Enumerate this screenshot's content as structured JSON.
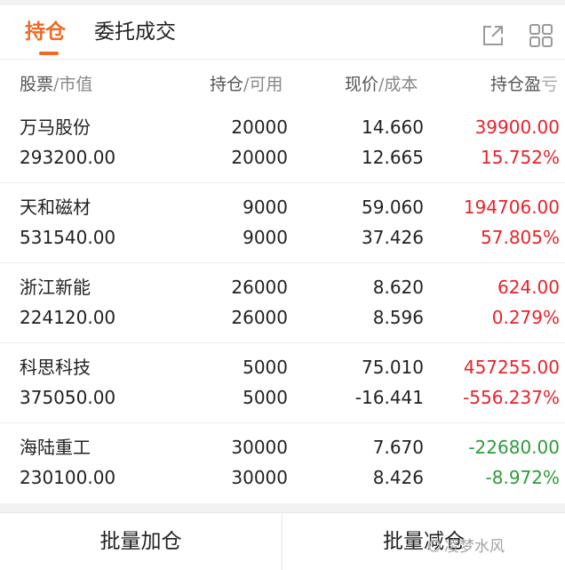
{
  "tabs": {
    "active": "持仓",
    "inactive": "委托成交"
  },
  "columns": {
    "stock": "股票",
    "stock_sub": "/市值",
    "qty": "持仓",
    "qty_sub": "/可用",
    "price": "现价",
    "price_sub": "/成本",
    "pnl": "持仓盈",
    "pnl_cut": "亏"
  },
  "holdings": [
    {
      "name": "万马股份",
      "market_value": "293200.00",
      "qty": "20000",
      "available": "20000",
      "price": "14.660",
      "cost": "12.665",
      "pnl": "39900.00",
      "pnl_pct": "15.752%",
      "pnl_sign": "pos"
    },
    {
      "name": "天和磁材",
      "market_value": "531540.00",
      "qty": "9000",
      "available": "9000",
      "price": "59.060",
      "cost": "37.426",
      "pnl": "194706.00",
      "pnl_pct": "57.805%",
      "pnl_sign": "pos"
    },
    {
      "name": "浙江新能",
      "market_value": "224120.00",
      "qty": "26000",
      "available": "26000",
      "price": "8.620",
      "cost": "8.596",
      "pnl": "624.00",
      "pnl_pct": "0.279%",
      "pnl_sign": "pos"
    },
    {
      "name": "科思科技",
      "market_value": "375050.00",
      "qty": "5000",
      "available": "5000",
      "price": "75.010",
      "cost": "-16.441",
      "pnl": "457255.00",
      "pnl_pct": "-556.237%",
      "pnl_sign": "pos"
    },
    {
      "name": "海陆重工",
      "market_value": "230100.00",
      "qty": "30000",
      "available": "30000",
      "price": "7.670",
      "cost": "8.426",
      "pnl": "-22680.00",
      "pnl_pct": "-8.972%",
      "pnl_sign": "neg"
    }
  ],
  "footer": {
    "add_label": "批量加仓",
    "reduce_label": "批量减仓"
  },
  "watermark": "凌梦水风",
  "colors": {
    "accent": "#f06a22",
    "up": "#e8232b",
    "down": "#2e9b3a"
  },
  "icons": {
    "share": "share-external-icon",
    "grid": "grid-apps-icon"
  }
}
